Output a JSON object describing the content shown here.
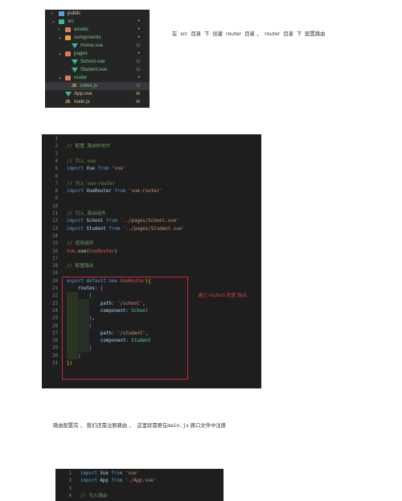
{
  "file_tree": [
    {
      "name": "public",
      "kind": "folder",
      "folder_color": "#55a3d6",
      "depth": 0,
      "expanded": false,
      "status": ""
    },
    {
      "name": "src",
      "kind": "folder",
      "folder_color": "#41b883",
      "depth": 0,
      "expanded": true,
      "status": "•"
    },
    {
      "name": "assets",
      "kind": "folder",
      "folder_color": "#e07a5f",
      "depth": 1,
      "expanded": false,
      "status": "•"
    },
    {
      "name": "components",
      "kind": "folder",
      "folder_color": "#e8a33c",
      "depth": 1,
      "expanded": true,
      "status": "•"
    },
    {
      "name": "Home.vue",
      "kind": "vue",
      "depth": 2,
      "status": "U"
    },
    {
      "name": "pages",
      "kind": "folder",
      "folder_color": "#e07a5f",
      "depth": 1,
      "expanded": true,
      "status": "•"
    },
    {
      "name": "School.vue",
      "kind": "vue",
      "depth": 2,
      "status": "U"
    },
    {
      "name": "Student.vue",
      "kind": "vue",
      "depth": 2,
      "status": "U"
    },
    {
      "name": "router",
      "kind": "folder",
      "folder_color": "#e07a5f",
      "depth": 1,
      "expanded": true,
      "status": "•"
    },
    {
      "name": "index.js",
      "kind": "js",
      "depth": 2,
      "status": "U",
      "selected": true
    },
    {
      "name": "App.vue",
      "kind": "vue",
      "depth": 1,
      "status": "M"
    },
    {
      "name": "main.js",
      "kind": "js",
      "depth": 1,
      "status": "M"
    }
  ],
  "note_top": "在  src  目录  下  创建  router  目录 ，  router  目录  下  配置路由",
  "code1": [
    {
      "n": "1",
      "tokens": []
    },
    {
      "n": "2",
      "tokens": [
        {
          "c": "c",
          "t": "// 配置 路由的地方"
        }
      ]
    },
    {
      "n": "3",
      "tokens": []
    },
    {
      "n": "4",
      "tokens": [
        {
          "c": "c",
          "t": "// 引入 vue"
        }
      ]
    },
    {
      "n": "5",
      "tokens": [
        {
          "c": "k",
          "t": "import "
        },
        {
          "c": "p",
          "t": "Vue "
        },
        {
          "c": "k",
          "t": "from "
        },
        {
          "c": "s",
          "t": "'vue'"
        }
      ]
    },
    {
      "n": "6",
      "tokens": []
    },
    {
      "n": "7",
      "tokens": [
        {
          "c": "c",
          "t": "// 引入 vue-router"
        }
      ]
    },
    {
      "n": "8",
      "tokens": [
        {
          "c": "k",
          "t": "import "
        },
        {
          "c": "p",
          "t": "VueRouter "
        },
        {
          "c": "k",
          "t": "from "
        },
        {
          "c": "s",
          "t": "'vue-router'"
        }
      ]
    },
    {
      "n": "9",
      "tokens": []
    },
    {
      "n": "10",
      "tokens": []
    },
    {
      "n": "11",
      "tokens": [
        {
          "c": "c",
          "t": "// 引入 路由组件"
        }
      ]
    },
    {
      "n": "12",
      "tokens": [
        {
          "c": "k",
          "t": "import "
        },
        {
          "c": "p",
          "t": "School "
        },
        {
          "c": "k",
          "t": "from "
        },
        {
          "c": "s",
          "t": "'../pages/School.vue'"
        }
      ]
    },
    {
      "n": "13",
      "tokens": [
        {
          "c": "k",
          "t": "import "
        },
        {
          "c": "p",
          "t": "Student "
        },
        {
          "c": "k",
          "t": "from "
        },
        {
          "c": "s",
          "t": "'../pages/Student.vue'"
        }
      ]
    },
    {
      "n": "14",
      "tokens": []
    },
    {
      "n": "15",
      "tokens": [
        {
          "c": "c",
          "t": "// 使用插件"
        }
      ]
    },
    {
      "n": "16",
      "tokens": [
        {
          "c": "r",
          "t": "Vue"
        },
        {
          "c": "",
          "t": "."
        },
        {
          "c": "f",
          "t": "use"
        },
        {
          "c": "y",
          "t": "("
        },
        {
          "c": "r",
          "t": "VueRouter"
        },
        {
          "c": "y",
          "t": ")"
        }
      ]
    },
    {
      "n": "17",
      "tokens": []
    },
    {
      "n": "18",
      "tokens": [
        {
          "c": "c",
          "t": "// 配置路由"
        }
      ]
    },
    {
      "n": "19",
      "tokens": []
    },
    {
      "n": "20",
      "tokens": [
        {
          "c": "k",
          "t": "export default new "
        },
        {
          "c": "r",
          "t": "VueRouter"
        },
        {
          "c": "y",
          "t": "({"
        }
      ]
    },
    {
      "n": "21",
      "tokens": [
        {
          "c": "",
          "t": "    "
        },
        {
          "c": "p",
          "t": "routes"
        },
        {
          "c": "",
          "t": ": "
        },
        {
          "c": "mg",
          "t": "["
        }
      ]
    },
    {
      "n": "22",
      "tokens": [
        {
          "c": "",
          "t": "        "
        },
        {
          "c": "k",
          "t": "{"
        }
      ]
    },
    {
      "n": "23",
      "tokens": [
        {
          "c": "",
          "t": "            "
        },
        {
          "c": "p",
          "t": "path"
        },
        {
          "c": "",
          "t": ": "
        },
        {
          "c": "s",
          "t": "'/school'"
        },
        {
          "c": "",
          "t": ","
        }
      ]
    },
    {
      "n": "24",
      "tokens": [
        {
          "c": "",
          "t": "            "
        },
        {
          "c": "p",
          "t": "component"
        },
        {
          "c": "",
          "t": ": "
        },
        {
          "c": "t",
          "t": "School"
        }
      ]
    },
    {
      "n": "25",
      "tokens": [
        {
          "c": "",
          "t": "        "
        },
        {
          "c": "k",
          "t": "}"
        },
        {
          "c": "",
          "t": ","
        }
      ]
    },
    {
      "n": "26",
      "tokens": [
        {
          "c": "",
          "t": "        "
        },
        {
          "c": "k",
          "t": "{"
        }
      ]
    },
    {
      "n": "27",
      "tokens": [
        {
          "c": "",
          "t": "            "
        },
        {
          "c": "p",
          "t": "path"
        },
        {
          "c": "",
          "t": ": "
        },
        {
          "c": "s",
          "t": "'/student'"
        },
        {
          "c": "",
          "t": ","
        }
      ]
    },
    {
      "n": "28",
      "tokens": [
        {
          "c": "",
          "t": "            "
        },
        {
          "c": "p",
          "t": "component"
        },
        {
          "c": "",
          "t": ": "
        },
        {
          "c": "t",
          "t": "Student"
        }
      ]
    },
    {
      "n": "29",
      "tokens": [
        {
          "c": "",
          "t": "        "
        },
        {
          "c": "k",
          "t": "}"
        }
      ]
    },
    {
      "n": "30",
      "tokens": [
        {
          "c": "",
          "t": "    "
        },
        {
          "c": "mg",
          "t": "]"
        }
      ]
    },
    {
      "n": "31",
      "tokens": [
        {
          "c": "y",
          "t": "})"
        }
      ]
    }
  ],
  "callout": "通过 routers 配置 路由",
  "note_bottom_pre": "路由配置完 ， 我们还需注册路由 ，  这里就需要在",
  "note_bottom_code": "main.js",
  "note_bottom_post": " 路口文件中注册",
  "code2": [
    {
      "n": "1",
      "tokens": [
        {
          "c": "k",
          "t": "import "
        },
        {
          "c": "p",
          "t": "Vue "
        },
        {
          "c": "k",
          "t": "from "
        },
        {
          "c": "s",
          "t": "'vue'"
        }
      ]
    },
    {
      "n": "2",
      "tokens": [
        {
          "c": "k",
          "t": "import "
        },
        {
          "c": "p",
          "t": "App "
        },
        {
          "c": "k",
          "t": "from "
        },
        {
          "c": "s",
          "t": "'./App.vue'"
        }
      ]
    },
    {
      "n": "3",
      "tokens": []
    },
    {
      "n": "4",
      "tokens": [
        {
          "c": "c",
          "t": "// 引入路由"
        }
      ]
    }
  ]
}
